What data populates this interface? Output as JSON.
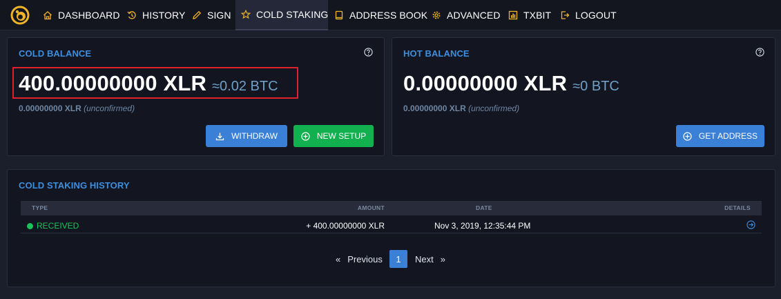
{
  "nav": {
    "items": [
      {
        "label": "DASHBOARD",
        "icon": "home-icon"
      },
      {
        "label": "HISTORY",
        "icon": "history-icon"
      },
      {
        "label": "SIGN",
        "icon": "pencil-icon"
      },
      {
        "label": "COLD STAKING",
        "icon": "star-icon"
      },
      {
        "label": "ADDRESS BOOK",
        "icon": "book-icon"
      },
      {
        "label": "ADVANCED",
        "icon": "gear-icon"
      },
      {
        "label": "TXBIT",
        "icon": "chart-icon"
      },
      {
        "label": "LOGOUT",
        "icon": "logout-icon"
      }
    ],
    "active": "COLD STAKING"
  },
  "cold": {
    "title": "COLD BALANCE",
    "amount": "400.00000000 XLR",
    "btc": "≈0.02 BTC",
    "unconfirmed_amount": "0.00000000 XLR",
    "unconfirmed_label": "(unconfirmed)",
    "withdraw_label": "WITHDRAW",
    "new_setup_label": "NEW SETUP"
  },
  "hot": {
    "title": "HOT BALANCE",
    "amount": "0.00000000 XLR",
    "btc": "≈0 BTC",
    "unconfirmed_amount": "0.00000000 XLR",
    "unconfirmed_label": "(unconfirmed)",
    "get_address_label": "GET ADDRESS"
  },
  "history": {
    "title": "COLD STAKING HISTORY",
    "columns": {
      "type": "TYPE",
      "amount": "AMOUNT",
      "date": "DATE",
      "details": "DETAILS"
    },
    "rows": [
      {
        "type": "RECEIVED",
        "amount": "+ 400.00000000 XLR",
        "date": "Nov 3, 2019, 12:35:44 PM"
      }
    ],
    "pagination": {
      "prev": "Previous",
      "page": "1",
      "next": "Next",
      "prev_arrow": "«",
      "next_arrow": "»"
    }
  },
  "colors": {
    "accent": "#3e8ede",
    "nav_icon": "#f0b429",
    "received": "#19c45a",
    "highlight": "#e0202a"
  }
}
